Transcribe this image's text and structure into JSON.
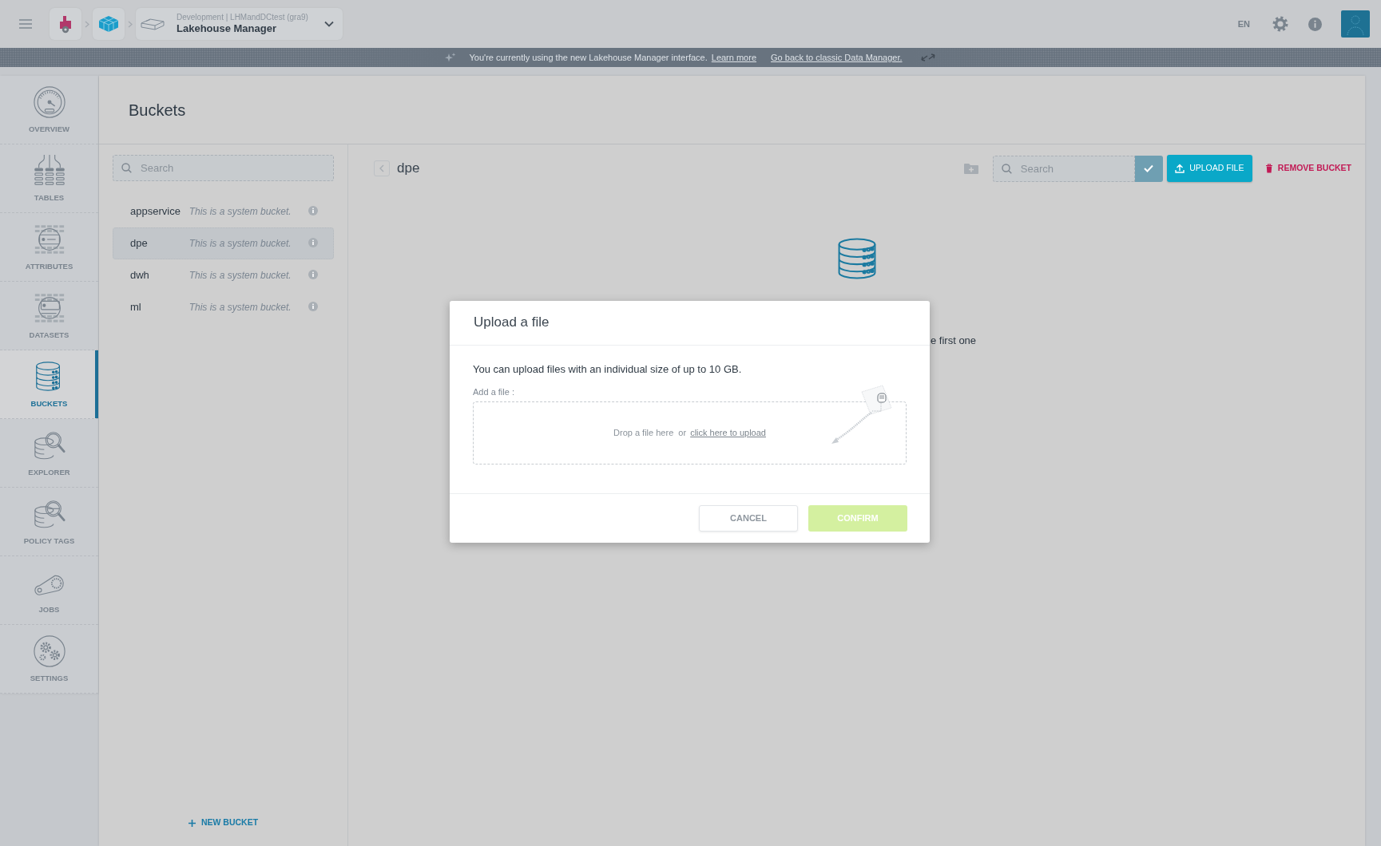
{
  "top_bar": {
    "app_switcher": {
      "environment": "Development | LHMandDCtest (gra9)",
      "title": "Lakehouse Manager"
    },
    "language": "EN"
  },
  "banner": {
    "message": "You're currently using the new Lakehouse Manager interface.",
    "links": [
      "Learn more",
      "Go back to classic Data Manager."
    ]
  },
  "sidebar": {
    "items": [
      {
        "label": "OVERVIEW",
        "selected": false
      },
      {
        "label": "TABLES",
        "selected": false
      },
      {
        "label": "ATTRIBUTES",
        "selected": false
      },
      {
        "label": "DATASETS",
        "selected": false
      },
      {
        "label": "BUCKETS",
        "selected": true
      },
      {
        "label": "EXPLORER",
        "selected": false
      },
      {
        "label": "POLICY TAGS",
        "selected": false
      },
      {
        "label": "JOBS",
        "selected": false
      },
      {
        "label": "SETTINGS",
        "selected": false
      }
    ]
  },
  "page": {
    "title": "Buckets"
  },
  "bucket_list": {
    "search": {
      "placeholder": "Search"
    },
    "items": [
      {
        "name": "appservice",
        "description": "This is a system bucket.",
        "selected": false
      },
      {
        "name": "dpe",
        "description": "This is a system bucket.",
        "selected": true
      },
      {
        "name": "dwh",
        "description": "This is a system bucket.",
        "selected": false
      },
      {
        "name": "ml",
        "description": "This is a system bucket.",
        "selected": false
      }
    ],
    "new_bucket_button": "NEW BUCKET"
  },
  "bucket_detail": {
    "title": "dpe",
    "search": {
      "placeholder": "Search"
    },
    "upload_button": "UPLOAD FILE",
    "remove_button": "REMOVE BUCKET",
    "empty_state_text": "e first one"
  },
  "dialog": {
    "title": "Upload a file",
    "message": "You can upload files with an individual size of up to 10 GB.",
    "field_label": "Add a file :",
    "dropzone": {
      "text": "Drop a file here  or",
      "link": "click here to upload"
    },
    "buttons": [
      {
        "label": "CANCEL",
        "kind": "secondary",
        "disabled": false
      },
      {
        "label": "CONFIRM",
        "kind": "primary",
        "disabled": true
      }
    ]
  }
}
